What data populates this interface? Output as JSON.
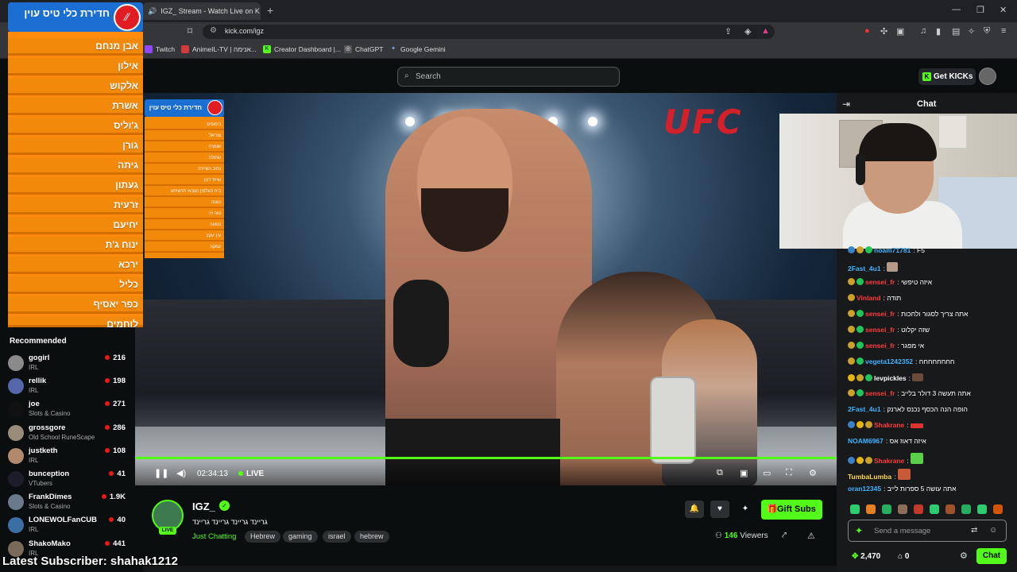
{
  "browser": {
    "tab_title": "IGZ_ Stream - Watch Live on K",
    "url": "kick.com/igz",
    "bookmarks": [
      "Twitch",
      "AnimeIL-TV | אנימה...",
      "Creator Dashboard |...",
      "ChatGPT",
      "Google Gemini"
    ]
  },
  "header": {
    "search_placeholder": "Search",
    "get_kicks": "Get KICKs"
  },
  "overlay": {
    "banner": "חדירת כלי טיס עוין",
    "items": [
      "אבן מנחם",
      "אילון",
      "אלקוש",
      "אשרת",
      "ג'וליס",
      "גורן",
      "גיתה",
      "געתון",
      "זרעית",
      "יחיעם",
      "ינוח ג'ת",
      "ירכא",
      "כליל",
      "כפר יאסיף",
      "לוחמים"
    ],
    "inner_banner": "חדירת כלי טיס עוין",
    "inner_items": [
      "כיסופים",
      "צוריאל",
      "שומרה",
      "שתולה",
      "נתיב השיירה",
      "שייח' דנון",
      "בית העלמין הצבאי תרשיחא",
      "טוונה",
      "נווה זיו",
      "נטועה",
      "עין יעקב",
      "עמקה"
    ]
  },
  "recommended": {
    "title": "Recommended",
    "items": [
      {
        "name": "gogirl",
        "category": "IRL",
        "viewers": "216"
      },
      {
        "name": "rellik",
        "category": "IRL",
        "viewers": "198"
      },
      {
        "name": "joe",
        "category": "Slots & Casino",
        "viewers": "271"
      },
      {
        "name": "grossgore",
        "category": "Old School RuneScape",
        "viewers": "286"
      },
      {
        "name": "justketh",
        "category": "IRL",
        "viewers": "108"
      },
      {
        "name": "bunception",
        "category": "VTubers",
        "viewers": "41"
      },
      {
        "name": "FrankDimes",
        "category": "Slots & Casino",
        "viewers": "1.9K"
      },
      {
        "name": "LONEWOLFanCUB",
        "category": "IRL",
        "viewers": "40"
      },
      {
        "name": "ShakoMako",
        "category": "IRL",
        "viewers": "441"
      }
    ],
    "latest_subscriber": "Latest Subscriber: shahak1212"
  },
  "video": {
    "brand": "UFC",
    "time": "02:34:13",
    "live": "LIVE"
  },
  "stream": {
    "channel": "IGZ_",
    "live_badge": "LIVE",
    "title": "גריינד גריינד גריינד גריינד",
    "category": "Just Chatting",
    "tags": [
      "Hebrew",
      "gaming",
      "israel",
      "hebrew"
    ],
    "gift_subs": "Gift Subs",
    "viewers": "146",
    "viewers_label": "Viewers"
  },
  "chat": {
    "title": "Chat",
    "messages": [
      {
        "user": "noam71781",
        "text": "F5",
        "color": "#3fb3ff"
      },
      {
        "user": "2Fast_4u1",
        "text": "",
        "color": "#3fb3ff"
      },
      {
        "user": "sensei_fr",
        "text": "איזה טיפשי",
        "color": "#ff3b3b"
      },
      {
        "user": "Vinland",
        "text": "תודה",
        "color": "#ff3b3b"
      },
      {
        "user": "sensei_fr",
        "text": "אתה צריך לסגור ולחכות",
        "color": "#ff3b3b"
      },
      {
        "user": "sensei_fr",
        "text": "שזה יקלוט",
        "color": "#ff3b3b"
      },
      {
        "user": "sensei_fr",
        "text": "אי מפגר",
        "color": "#ff3b3b"
      },
      {
        "user": "vegeta1242352",
        "text": "חחחחחחחח",
        "color": "#3fb3ff"
      },
      {
        "user": "levpickles",
        "text": "",
        "color": "#ffffff"
      },
      {
        "user": "sensei_fr",
        "text": "אתה תעשה 3 דולר בלייב",
        "color": "#ff3b3b"
      },
      {
        "user": "2Fast_4u1",
        "text": "הופה הנה הכסף נכנס לארנק",
        "color": "#3fb3ff"
      },
      {
        "user": "Shakrane",
        "text": "",
        "color": "#ff3b3b"
      },
      {
        "user": "NOAM6967",
        "text": "איזה דאוז אס",
        "color": "#3fb3ff"
      },
      {
        "user": "Shakrane",
        "text": "",
        "color": "#ff3b3b"
      },
      {
        "user": "TumbaLumba",
        "text": "",
        "color": "#ffd84a"
      },
      {
        "user": "oran12345",
        "text": "אתה עושה 5 ספרות לייב",
        "color": "#3fb3ff"
      }
    ],
    "send_placeholder": "Send a message",
    "points": "2,470",
    "zero": "0",
    "chat_button": "Chat"
  }
}
